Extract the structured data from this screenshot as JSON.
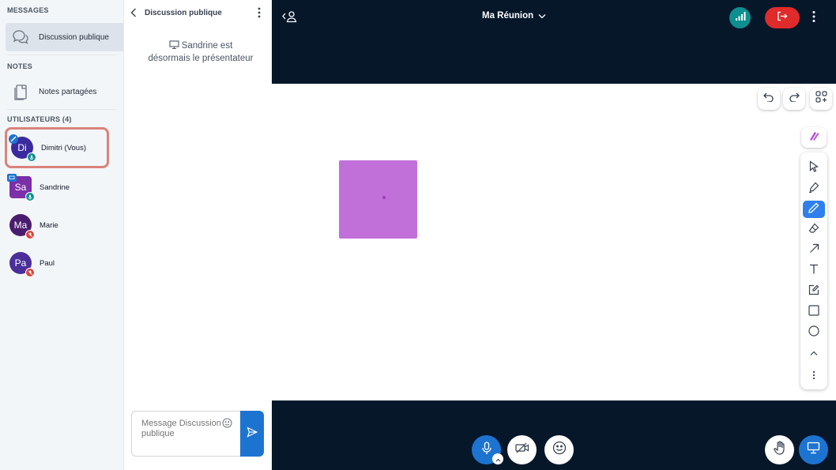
{
  "sidebar": {
    "messages_title": "MESSAGES",
    "public_chat_label": "Discussion publique",
    "notes_title": "NOTES",
    "shared_notes_label": "Notes partagées",
    "users_title": "UTILISATEURS (4)",
    "users": [
      {
        "initials": "Di",
        "name": "Dimitri (Vous)",
        "color": "#3b2a9e",
        "mic": "on",
        "shape": "circle"
      },
      {
        "initials": "Sa",
        "name": "Sandrine",
        "color": "#7b2fa8",
        "mic": "on",
        "shape": "square"
      },
      {
        "initials": "Ma",
        "name": "Marie",
        "color": "#4a1c6e",
        "mic": "muted",
        "shape": "circle"
      },
      {
        "initials": "Pa",
        "name": "Paul",
        "color": "#4a2e9a",
        "mic": "muted",
        "shape": "circle"
      }
    ]
  },
  "chat": {
    "title": "Discussion publique",
    "system_message": "Sandrine est désormais le présentateur",
    "input_placeholder": "Message Discussion publique"
  },
  "topbar": {
    "meeting_title": "Ma Réunion"
  },
  "colors": {
    "navy": "#06172a",
    "primary_blue": "#1d74d0",
    "leave_red": "#e02b2b",
    "status_teal": "#0e8f8f",
    "shape_fill": "#c170d9",
    "highlight_border": "#d9837b"
  },
  "whiteboard": {
    "tools": [
      "select-icon",
      "pencil-icon",
      "pen-icon",
      "eraser-icon",
      "arrow-icon",
      "text-icon",
      "note-icon",
      "rectangle-icon",
      "ellipse-icon",
      "chevron-up-icon",
      "more-icon"
    ],
    "active_tool": "pen-icon"
  }
}
